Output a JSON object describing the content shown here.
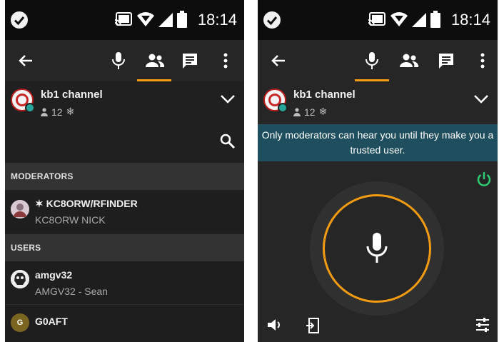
{
  "left_screen": {
    "status_bar": {
      "time": "18:14",
      "icons": [
        "check-circle-icon",
        "cast-icon",
        "wifi-icon",
        "signal-icon",
        "battery-icon"
      ]
    },
    "toolbar": {
      "active_tab": "users",
      "icons": [
        "back-arrow-icon",
        "microphone-icon",
        "users-icon",
        "chat-icon",
        "more-vert-icon"
      ]
    },
    "channel": {
      "name": "kb1 channel",
      "user_count": "12"
    },
    "sections": {
      "moderators": "MODERATORS",
      "users": "USERS"
    },
    "moderators": [
      {
        "name": "✶ KC8ORW/RFINDER",
        "subtitle": "KC8ORW NICK"
      }
    ],
    "users": [
      {
        "name": "amgv32",
        "subtitle": "AMGV32 - Sean"
      },
      {
        "name": "G0AFT",
        "avatar_letter": "G"
      }
    ]
  },
  "right_screen": {
    "status_bar": {
      "time": "18:14"
    },
    "toolbar": {
      "active_tab": "microphone"
    },
    "channel": {
      "name": "kb1 channel",
      "user_count": "12"
    },
    "banner": "Only moderators can hear you until they make you a trusted user.",
    "bottom_icons": [
      "volume-icon",
      "exit-icon",
      "equalizer-icon"
    ]
  },
  "colors": {
    "accent": "#f39c12",
    "banner_bg": "#1f4f5e",
    "power_green": "#2ecc71"
  }
}
